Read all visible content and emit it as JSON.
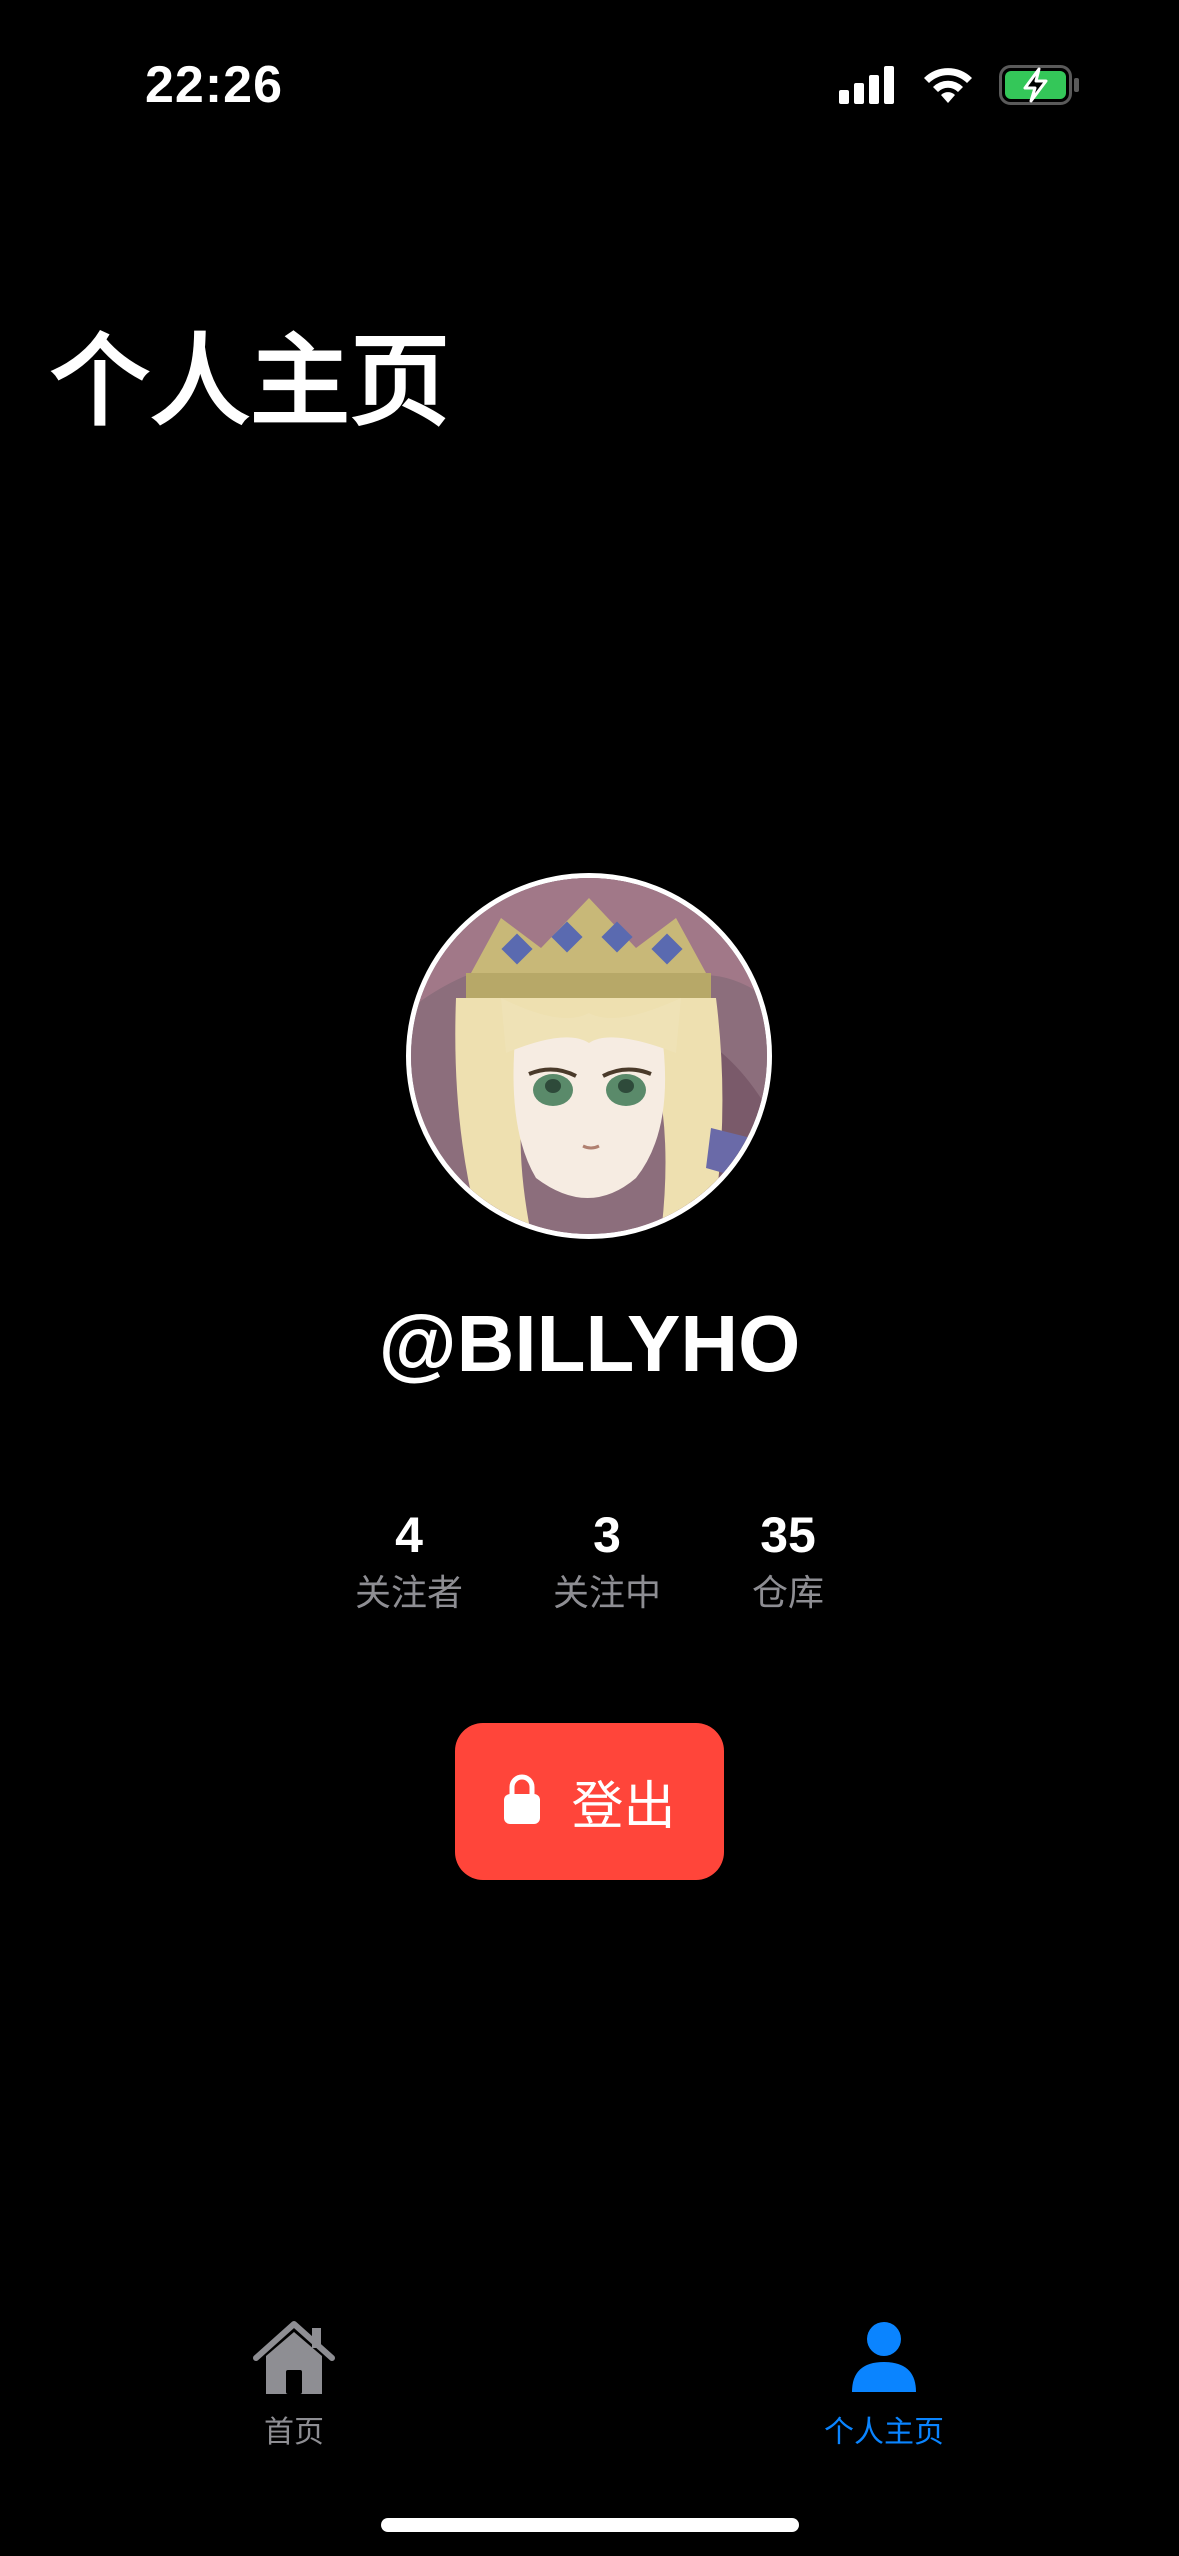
{
  "status_bar": {
    "time": "22:26",
    "icons": [
      "signal-icon",
      "wifi-icon",
      "battery-charging-icon"
    ]
  },
  "page": {
    "title": "个人主页"
  },
  "profile": {
    "username": "@BILLYHO",
    "stats": [
      {
        "value": "4",
        "label": "关注者"
      },
      {
        "value": "3",
        "label": "关注中"
      },
      {
        "value": "35",
        "label": "仓库"
      }
    ]
  },
  "actions": {
    "logout_label": "登出",
    "logout_color": "#ff453a"
  },
  "tab_bar": {
    "items": [
      {
        "label": "首页",
        "icon": "home-icon",
        "selected": false
      },
      {
        "label": "个人主页",
        "icon": "person-icon",
        "selected": true
      }
    ],
    "active_color": "#0a84ff",
    "inactive_color": "#8e8e93"
  }
}
